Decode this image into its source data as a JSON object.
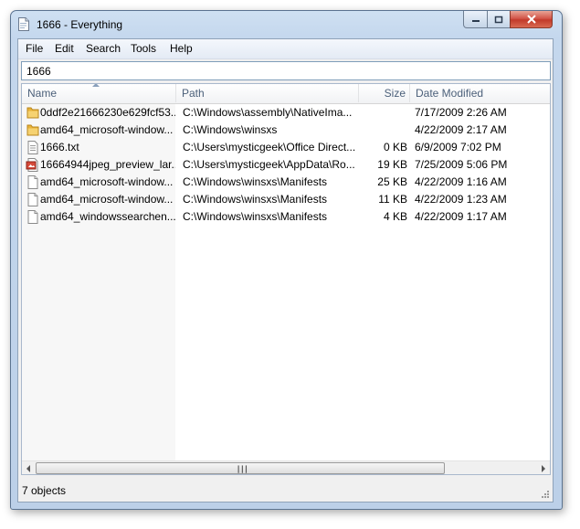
{
  "window": {
    "title": "1666 - Everything"
  },
  "menu": [
    {
      "label": "File"
    },
    {
      "label": "Edit"
    },
    {
      "label": "Search"
    },
    {
      "label": "Tools"
    },
    {
      "label": "Help"
    }
  ],
  "search": {
    "value": "1666"
  },
  "columns": {
    "name": "Name",
    "path": "Path",
    "size": "Size",
    "date": "Date Modified"
  },
  "rows": [
    {
      "icon": "folder-icon",
      "name": "0ddf2e21666230e629fcf53...",
      "path": "C:\\Windows\\assembly\\NativeIma...",
      "size": "",
      "date": "7/17/2009 2:26 AM"
    },
    {
      "icon": "folder-icon",
      "name": "amd64_microsoft-window...",
      "path": "C:\\Windows\\winsxs",
      "size": "",
      "date": "4/22/2009 2:17 AM"
    },
    {
      "icon": "text-file-icon",
      "name": "1666.txt",
      "path": "C:\\Users\\mysticgeek\\Office Direct...",
      "size": "0 KB",
      "date": "6/9/2009 7:02 PM"
    },
    {
      "icon": "image-file-icon",
      "name": "16664944jpeg_preview_lar...",
      "path": "C:\\Users\\mysticgeek\\AppData\\Ro...",
      "size": "19 KB",
      "date": "7/25/2009 5:06 PM"
    },
    {
      "icon": "file-icon",
      "name": "amd64_microsoft-window...",
      "path": "C:\\Windows\\winsxs\\Manifests",
      "size": "25 KB",
      "date": "4/22/2009 1:16 AM"
    },
    {
      "icon": "file-icon",
      "name": "amd64_microsoft-window...",
      "path": "C:\\Windows\\winsxs\\Manifests",
      "size": "11 KB",
      "date": "4/22/2009 1:23 AM"
    },
    {
      "icon": "file-icon",
      "name": "amd64_windowssearchen...",
      "path": "C:\\Windows\\winsxs\\Manifests",
      "size": "4 KB",
      "date": "4/22/2009 1:17 AM"
    }
  ],
  "status": {
    "text": "7 objects"
  },
  "colors": {
    "folder": "#e8b33a",
    "accent": "#4c607a",
    "close": "#c23a2b"
  }
}
